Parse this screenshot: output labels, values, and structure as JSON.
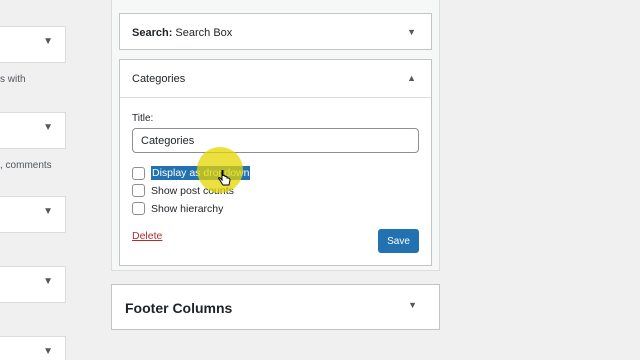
{
  "left_panel": {
    "partial_texts": [
      "s with",
      ", comments"
    ]
  },
  "search_widget": {
    "label": "Search:",
    "name": "Search Box"
  },
  "categories_widget": {
    "header": "Categories",
    "title_label": "Title:",
    "title_value": "Categories",
    "options": [
      {
        "label": "Display as dropdown",
        "checked": false,
        "selected": true
      },
      {
        "label": "Show post counts",
        "checked": false
      },
      {
        "label": "Show hierarchy",
        "checked": false
      }
    ],
    "delete_label": "Delete",
    "save_label": "Save"
  },
  "footer_area": {
    "title": "Footer Columns"
  },
  "colors": {
    "accent": "#2271b1",
    "delete": "#b32d2e",
    "highlight": "#e6d600"
  }
}
